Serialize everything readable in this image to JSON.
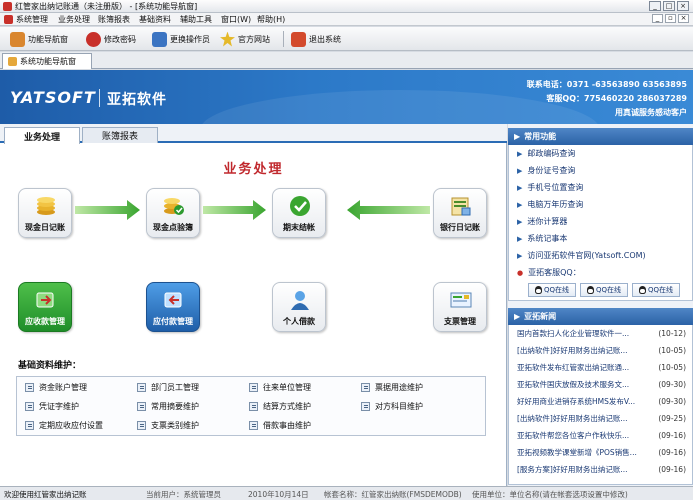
{
  "window": {
    "title": "红管家出纳记账通（未注册版） - [系统功能导航窗]",
    "buttons": [
      "_",
      "□",
      "×"
    ]
  },
  "menu": [
    "系统管理",
    "业务处理",
    "账簿报表",
    "基础资料",
    "辅助工具",
    "窗口(W)",
    "帮助(H)"
  ],
  "toolbar": [
    {
      "label": "功能导航窗",
      "icon": "home-icon",
      "color": "#d9862e"
    },
    {
      "label": "修改密码",
      "icon": "password-icon",
      "color": "#c8302a"
    },
    {
      "label": "更换操作员",
      "icon": "user-switch-icon",
      "color": "#3b74c2"
    },
    {
      "label": "官方网站",
      "icon": "star-icon",
      "color": "#e5b92a"
    },
    {
      "label": "退出系统",
      "icon": "exit-icon",
      "color": "#d34a2c"
    }
  ],
  "doc_tab": {
    "label": "系统功能导航窗"
  },
  "banner": {
    "logo": "YATSOFT",
    "company": "亚拓软件",
    "phone": "联系电话：0371 -63563890   63563895",
    "qq": "客服QQ：775460220   286037289",
    "slogan": "用真诚服务感动客户"
  },
  "main_tabs": [
    "业务处理",
    "账簿报表"
  ],
  "flow_title": "业务处理",
  "flow_nodes": [
    {
      "label": "现金日记账",
      "icon": "coins-icon"
    },
    {
      "label": "现金点验簿",
      "icon": "coins-check-icon"
    },
    {
      "label": "期末结帐",
      "icon": "check-circle-icon"
    },
    {
      "label": "银行日记账",
      "icon": "bank-ledger-icon"
    },
    {
      "label": "应收款管理",
      "icon": "receivable-icon"
    },
    {
      "label": "应付款管理",
      "icon": "payable-icon"
    },
    {
      "label": "个人借款",
      "icon": "person-icon"
    },
    {
      "label": "支票管理",
      "icon": "cheque-icon"
    }
  ],
  "basic_section": {
    "label": "基础资料维护：",
    "items": [
      "资金账户管理",
      "部门员工管理",
      "往来单位管理",
      "票据用途维护",
      "凭证字维护",
      "常用摘要维护",
      "结算方式维护",
      "对方科目维护",
      "定期应收应付设置",
      "支票类别维护",
      "借款事由维护"
    ]
  },
  "side": {
    "common_title": "常用功能",
    "common_links": [
      "邮政编码查询",
      "身份证号查询",
      "手机号位置查询",
      "电脑万年历查询",
      "迷你计算器",
      "系统记事本",
      "访问亚拓软件官网(Yatsoft.COM)"
    ],
    "qq_label": "亚拓客服QQ：",
    "qq_buttons": [
      "QQ在线",
      "QQ在线",
      "QQ在线"
    ],
    "news_title": "亚拓新闻",
    "news": [
      {
        "title": "国内首款扫人化企业管理软件一...",
        "date": "(10-12)"
      },
      {
        "title": "[出纳软件]好好用财务出纳记账...",
        "date": "(10-05)"
      },
      {
        "title": "亚拓软件发布红管家出纳记账通...",
        "date": "(10-05)"
      },
      {
        "title": "亚拓软件国庆放假及技术服务文...",
        "date": "(09-30)"
      },
      {
        "title": "好好用商业进销存系统HMS发布V...",
        "date": "(09-30)"
      },
      {
        "title": "[出纳软件]好好用财务出纳记账...",
        "date": "(09-25)"
      },
      {
        "title": "亚拓软件帮您各位客户作秋快乐...",
        "date": "(09-16)"
      },
      {
        "title": "亚拓视频教学课堂新增《POS销售...",
        "date": "(09-16)"
      },
      {
        "title": "[服务方案]好好用财务出纳记账...",
        "date": "(09-16)"
      }
    ]
  },
  "status": {
    "welcome": "欢迎使用红管家出纳记账",
    "user": "当前用户：系统管理员",
    "date": "2010年10月14日",
    "book": "帐套名称：红管家出纳账(FMSDEMODB)",
    "unit": "使用单位：单位名称(请在帐套选项设置中修改)"
  }
}
